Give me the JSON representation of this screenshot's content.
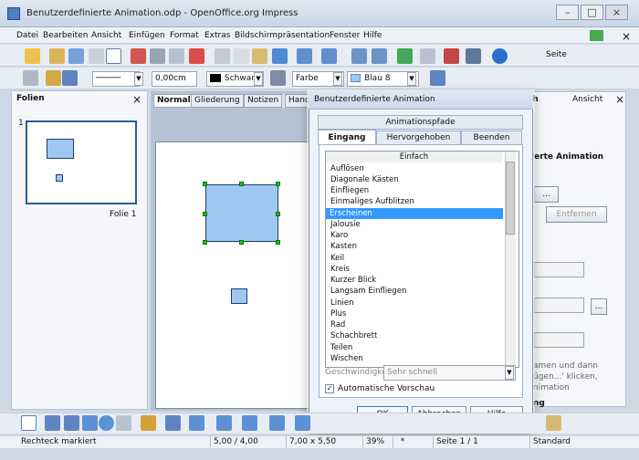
{
  "window": {
    "title": "Benutzerdefinierte Animation.odp - OpenOffice.org Impress"
  },
  "menu": [
    "Datei",
    "Bearbeiten",
    "Ansicht",
    "Einfügen",
    "Format",
    "Extras",
    "Bildschirmpräsentation",
    "Fenster",
    "Hilfe"
  ],
  "toolbar": {
    "side_label": "Seite",
    "line_width": "0,00cm",
    "line_color": "Schwarz",
    "fill_type": "Farbe",
    "fill_color": "Blau 8"
  },
  "left_panel": {
    "title": "Folien",
    "slide_number": "1",
    "slide_label": "Folie 1"
  },
  "view_tabs": [
    "Normal",
    "Gliederung",
    "Notizen",
    "Hand"
  ],
  "right_panel": {
    "header_right": "Ansicht",
    "header_right2": "ch",
    "section_title": "ierte Animation",
    "remove_button": "Entfernen",
    "help_fragment_1": "amen und dann",
    "help_fragment_2": "ügen...' klicken,",
    "help_fragment_3": "nimation",
    "bottom_label": "ng"
  },
  "dialog": {
    "title": "Benutzerdefinierte Animation",
    "path_tab": "Animationspfade",
    "tabs": [
      "Eingang",
      "Hervorgehoben",
      "Beenden"
    ],
    "group_header": "Einfach",
    "effects": [
      "Auflösen",
      "Diagonale Kästen",
      "Einfliegen",
      "Einmaliges Aufblitzen",
      "Erscheinen",
      "Jalousie",
      "Karo",
      "Kasten",
      "Keil",
      "Kreis",
      "Kurzer Blick",
      "Langsam Einfliegen",
      "Linien",
      "Plus",
      "Rad",
      "Schachbrett",
      "Teilen",
      "Wischen"
    ],
    "selected": "Erscheinen",
    "speed_label": "Geschwindigke",
    "speed_value": "Sehr schnell",
    "preview_label": "Automatische Vorschau",
    "ok": "OK",
    "cancel": "Abbrechen",
    "help": "Hilfe"
  },
  "status": {
    "mode": "Rechteck markiert",
    "position": "5,00 / 4,00",
    "size": "7,00 x 5,50",
    "zoom": "39%",
    "modified": "*",
    "slide": "Seite 1 / 1",
    "layout": "Standard"
  }
}
